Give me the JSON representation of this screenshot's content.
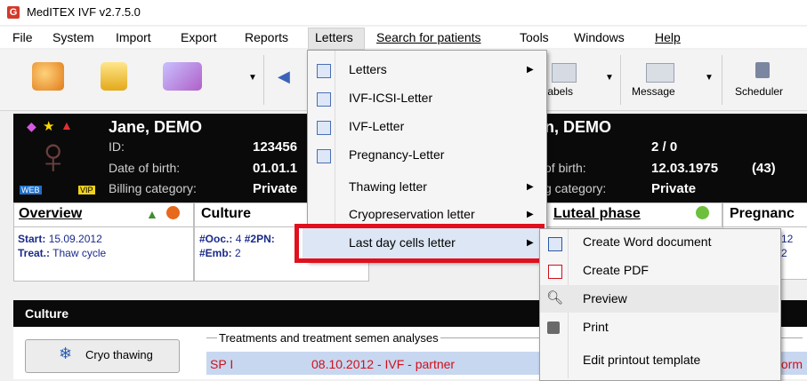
{
  "window": {
    "title": "MedITEX IVF v2.7.5.0",
    "app_icon": "G"
  },
  "menubar": [
    "File",
    "System",
    "Import",
    "Export",
    "Reports",
    "Letters",
    "Search for patients",
    "Tools",
    "Windows",
    "Help"
  ],
  "toolbar": {
    "labels_partial": "t labels",
    "message": "Message",
    "scheduler": "Scheduler"
  },
  "patient": {
    "name": "Jane, DEMO",
    "partner_name": "n, DEMO",
    "id_label": "ID:",
    "id_value": "123456",
    "dob_label": "Date of birth:",
    "dob_value": "01.01.1",
    "billing_label": "Billing category:",
    "billing_value": "Private",
    "partner_id_value": "2 / 0",
    "partner_dob_label": "of birth:",
    "partner_dob_value": "12.03.1975",
    "partner_age": "(43)",
    "partner_billing_label": "g category:",
    "partner_billing_value": "Private",
    "badge_web": "WEB",
    "badge_vip": "VIP"
  },
  "tabs": {
    "overview": "Overview",
    "culture": "Culture",
    "luteal": "Luteal phase",
    "pregnancy": "Pregnanc"
  },
  "overview_body": {
    "start_label": "Start:",
    "start_value": "15.09.2012",
    "treat_label": "Treat.:",
    "treat_value": "Thaw cycle"
  },
  "culture_body": {
    "line1_label": "#Ooc.:",
    "line1_value": "4",
    "line1_label2": "#2PN:",
    "line2_label": "#Emb:",
    "line2_value": "2"
  },
  "pregnancy_body": {
    "line1": "12",
    "line2": "2"
  },
  "culture_section": {
    "title": "Culture",
    "cryo_button": "Cryo thawing",
    "group_title": "Treatments and treatment semen analyses",
    "row_col1": "SP I",
    "row_col2": "08.10.2012 - IVF - partner",
    "row_col3": "form"
  },
  "letters_menu": [
    {
      "label": "Letters",
      "submenu": true
    },
    {
      "label": "IVF-ICSI-Letter",
      "submenu": false
    },
    {
      "label": "IVF-Letter",
      "submenu": false
    },
    {
      "label": "Pregnancy-Letter",
      "submenu": false
    },
    {
      "label": "Thawing letter",
      "submenu": true
    },
    {
      "label": "Cryopreservation letter",
      "submenu": true
    },
    {
      "label": "Last day cells letter",
      "submenu": true
    }
  ],
  "last_day_submenu": [
    {
      "label": "Create Word document",
      "icon": "word-icon"
    },
    {
      "label": "Create PDF",
      "icon": "pdf-icon"
    },
    {
      "label": "Preview",
      "icon": "magnifier-icon"
    },
    {
      "label": "Print",
      "icon": "printer-icon"
    },
    {
      "label": "Edit printout template",
      "icon": ""
    }
  ],
  "colors": {
    "highlight_box": "#e0101e",
    "panel": "#0a0a0a",
    "selected_row": "#c8d7f0",
    "red_text": "#d0101a"
  }
}
